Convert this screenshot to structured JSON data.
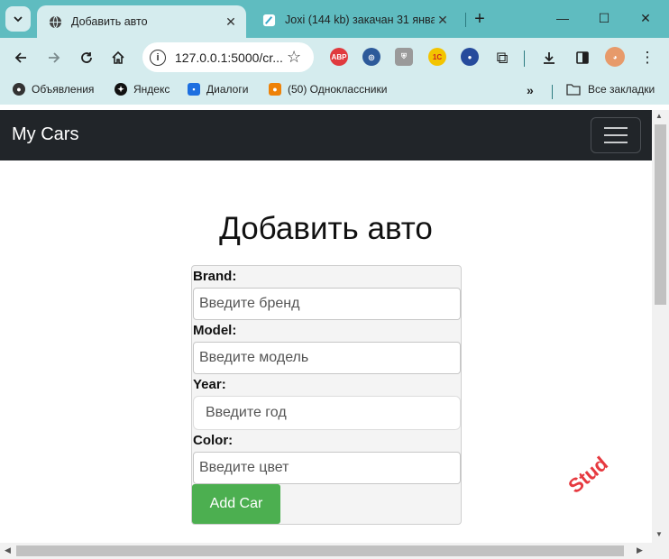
{
  "browser": {
    "tabs": [
      {
        "title": "Добавить авто",
        "active": true,
        "icon": "globe-icon"
      },
      {
        "title": "Joxi (144 kb) закачан 31 январ",
        "active": false,
        "icon": "joxi-icon"
      }
    ],
    "url": "127.0.0.1:5000/cr...",
    "bookmarks": [
      {
        "label": "Объявления",
        "icon": "avito-icon"
      },
      {
        "label": "Яндекс",
        "icon": "yandex-icon"
      },
      {
        "label": "Диалоги",
        "icon": "chat-icon"
      },
      {
        "label": "(50) Одноклассники",
        "icon": "ok-icon"
      }
    ],
    "all_bookmarks": "Все закладки",
    "extensions": {
      "abp_label": "ABP"
    },
    "colors": {
      "tab_bar": "#5fbcc0",
      "toolbar": "#d5ecee"
    }
  },
  "navbar": {
    "brand": "My Cars"
  },
  "page": {
    "title": "Добавить авто"
  },
  "form": {
    "fields": [
      {
        "label": "Brand:",
        "placeholder": "Введите бренд"
      },
      {
        "label": "Model:",
        "placeholder": "Введите модель"
      },
      {
        "label": "Year:",
        "placeholder": "Введите год"
      },
      {
        "label": "Color:",
        "placeholder": "Введите цвет"
      }
    ],
    "submit_label": "Add Car",
    "button_color": "#4caf50"
  },
  "watermark": "Stud"
}
